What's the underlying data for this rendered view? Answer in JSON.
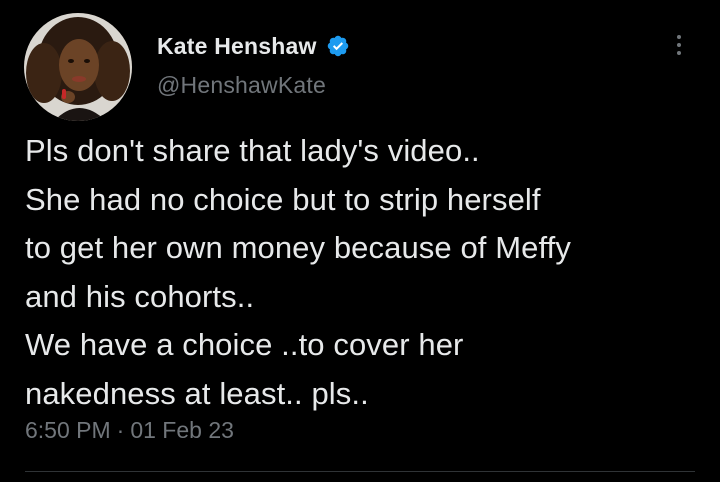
{
  "author": {
    "display_name": "Kate Henshaw",
    "handle": "@HenshawKate",
    "verified": true,
    "verified_color": "#1d9bf0"
  },
  "tweet": {
    "lines": [
      "Pls don't share that lady's video..",
      "She had no choice but to strip herself",
      "to get her own money because of Meffy",
      "and his cohorts..",
      "We have a choice ..to cover her",
      "nakedness at least.. pls.."
    ],
    "time": "6:50 PM",
    "separator": "·",
    "date": "01 Feb 23"
  },
  "icons": {
    "more": "more-vertical-icon",
    "verified": "verified-badge-icon"
  },
  "colors": {
    "background": "#000000",
    "text_primary": "#e7e9ea",
    "text_secondary": "#71767b",
    "divider": "#2f3336"
  }
}
